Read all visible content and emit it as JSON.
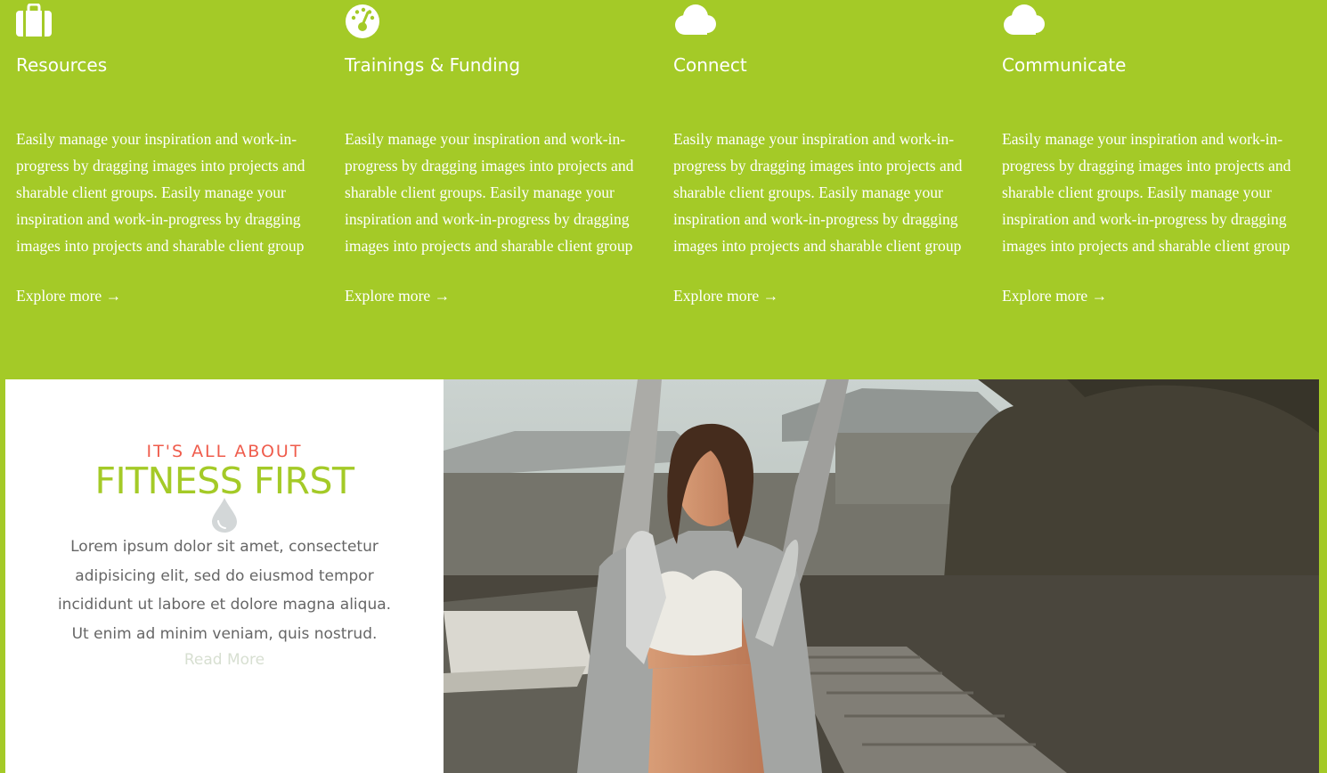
{
  "colors": {
    "accent_green": "#a4ca27",
    "heading_coral": "#ef5c4c",
    "body_gray": "#666666",
    "read_more_light": "#d7dfd1"
  },
  "features": [
    {
      "icon": "briefcase-icon",
      "title": "Resources",
      "description": "Easily manage your inspiration and work-in-progress by dragging images into projects and sharable client groups. Easily manage your inspiration and work-in-progress by dragging images into projects and sharable client group",
      "link": "Explore more →"
    },
    {
      "icon": "speedometer-icon",
      "title": "Trainings & Funding",
      "description": "Easily manage your inspiration and work-in-progress by dragging images into projects and sharable client groups. Easily manage your inspiration and work-in-progress by dragging images into projects and sharable client group",
      "link": "Explore more →"
    },
    {
      "icon": "cloud-icon",
      "title": "Connect",
      "description": "Easily manage your inspiration and work-in-progress by dragging images into projects and sharable client groups. Easily manage your inspiration and work-in-progress by dragging images into projects and sharable client group",
      "link": "Explore more →"
    },
    {
      "icon": "cloud-icon",
      "title": "Communicate",
      "description": "Easily manage your inspiration and work-in-progress by dragging images into projects and sharable client groups. Easily manage your inspiration and work-in-progress by dragging images into projects and sharable client group",
      "link": "Explore more →"
    }
  ],
  "promo": {
    "eyebrow": "IT'S ALL ABOUT",
    "headline": "FITNESS FIRST",
    "divider_icon": "water-drop-icon",
    "body": "Lorem ipsum dolor sit amet, consectetur adipisicing elit, sed do eiusmod tempor incididunt ut labore et dolore magna aliqua. Ut enim ad minim veniam, quis nostrud.",
    "read_more": "Read More"
  },
  "photo": {
    "subject": "woman stretching arms up on a dock at sunset"
  }
}
